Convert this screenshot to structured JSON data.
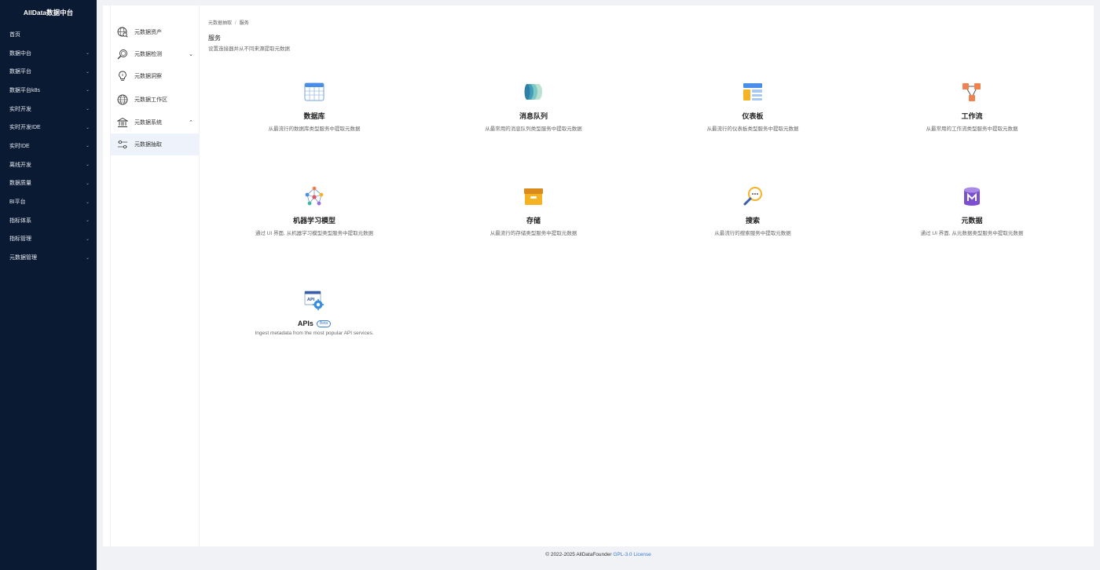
{
  "sidebar": {
    "brand": "AllData数据中台",
    "items": [
      {
        "label": "首页",
        "chevron": false
      },
      {
        "label": "数据中台",
        "chevron": true
      },
      {
        "label": "数据平台",
        "chevron": true
      },
      {
        "label": "数据平台k8s",
        "chevron": true
      },
      {
        "label": "实时开发",
        "chevron": true
      },
      {
        "label": "实时开发IDE",
        "chevron": true
      },
      {
        "label": "实时IDE",
        "chevron": true
      },
      {
        "label": "离线开发",
        "chevron": true
      },
      {
        "label": "数据质量",
        "chevron": true
      },
      {
        "label": "BI平台",
        "chevron": true
      },
      {
        "label": "指标体系",
        "chevron": true
      },
      {
        "label": "指标管理",
        "chevron": true
      },
      {
        "label": "元数据管理",
        "chevron": true
      }
    ]
  },
  "submenu": {
    "items": [
      {
        "label": "元数据资产",
        "icon": "globe-search-icon",
        "arrow": ""
      },
      {
        "label": "元数据检测",
        "icon": "magnifier-icon",
        "arrow": "⌄"
      },
      {
        "label": "元数据洞察",
        "icon": "lightbulb-icon",
        "arrow": ""
      },
      {
        "label": "元数据工作区",
        "icon": "globe-icon",
        "arrow": ""
      },
      {
        "label": "元数据系统",
        "icon": "bank-icon",
        "arrow": "⌃"
      },
      {
        "label": "元数据抽取",
        "icon": "sliders-icon",
        "arrow": ""
      }
    ]
  },
  "breadcrumb": {
    "parent": "元数据抽取",
    "separator": "/",
    "current": "服务"
  },
  "page": {
    "title": "服务",
    "subtitle": "设置连接器并从不同来源提取元数据"
  },
  "cards": [
    {
      "title": "数据库",
      "desc": "从最流行的数据库类型服务中提取元数据",
      "icon": "database-table-icon"
    },
    {
      "title": "消息队列",
      "desc": "从最常用的消息队列类型服务中提取元数据",
      "icon": "message-queue-icon"
    },
    {
      "title": "仪表板",
      "desc": "从最流行的仪表板类型服务中提取元数据",
      "icon": "dashboard-icon"
    },
    {
      "title": "工作流",
      "desc": "从最常用的工作流类型服务中提取元数据",
      "icon": "workflow-icon"
    },
    {
      "title": "机器学习模型",
      "desc": "通过 UI 界面, 从机器学习模型类型服务中提取元数据",
      "icon": "ml-model-icon"
    },
    {
      "title": "存储",
      "desc": "从最流行的存储类型服务中提取元数据",
      "icon": "storage-box-icon"
    },
    {
      "title": "搜索",
      "desc": "从最流行的搜索服务中提取元数据",
      "icon": "search-service-icon"
    },
    {
      "title": "元数据",
      "desc": "通过 UI 界面, 从元数据类型服务中提取元数据",
      "icon": "metadata-db-icon"
    },
    {
      "title": "APIs",
      "badge": "Beta",
      "desc": "Ingest metadata from the most popular API services.",
      "icon": "api-gear-icon"
    }
  ],
  "footer": {
    "copyright": "© 2022-2025 AllDataFounder",
    "license": "GPL-3.0 License"
  }
}
